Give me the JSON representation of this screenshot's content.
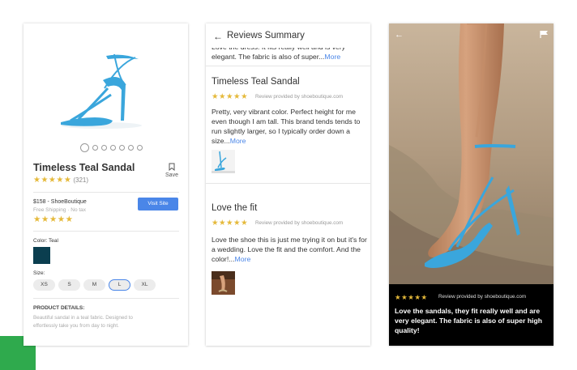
{
  "product": {
    "title": "Timeless Teal Sandal",
    "rating_stars": "★★★★★",
    "review_count": "(321)",
    "save_label": "Save",
    "price_line": "$158 - ShoeBoutique",
    "shipping_line": "Free Shipping · No tax",
    "visit_label": "Visit Site",
    "seller_stars": "★★★★★",
    "color_label": "Color: Teal",
    "color_hex": "#0b3e4f",
    "size_label": "Size:",
    "sizes": [
      "XS",
      "S",
      "M",
      "L",
      "XL"
    ],
    "selected_size": "L",
    "details_label": "PRODUCT DETAILS:",
    "details_text": "Beautiful sandal in a teal fabric. Designed to effortlessly take you from day to night."
  },
  "reviews_panel": {
    "back_icon": "arrow-left-icon",
    "title": "Reviews Summary",
    "clipped_text": "Love the dress. It fits really well and is very elegant. The fabric is also of super...",
    "clipped_more": "More",
    "reviews": [
      {
        "title": "Timeless Teal Sandal",
        "stars": "★★★★★",
        "provider": "Review provided by shoeboutique.com",
        "text": "Pretty, very vibrant color. Perfect height for me even though I am tall. This brand tends tends to run slightly larger, so I typically order down a size...",
        "more": "More"
      },
      {
        "title": "Love the fit",
        "stars": "★★★★★",
        "provider": "Review provided by shoeboutique.com",
        "text": "Love the shoe this is just me trying it on but it's for a wedding. Love the fit and the comfort. And the color!...",
        "more": "More"
      }
    ]
  },
  "photo_panel": {
    "back_icon": "arrow-left-icon",
    "flag_icon": "flag-icon",
    "stars": "★★★★★",
    "provider": "Review provided by shoeboutique.com",
    "text": "Love the sandals, they fit really well and are very elegant. The fabric is also of super high quality!"
  },
  "colors": {
    "accent": "#4a86e8",
    "star": "#e5b93a",
    "sandal": "#3aa6dc",
    "green_corner": "#2faa4d"
  }
}
